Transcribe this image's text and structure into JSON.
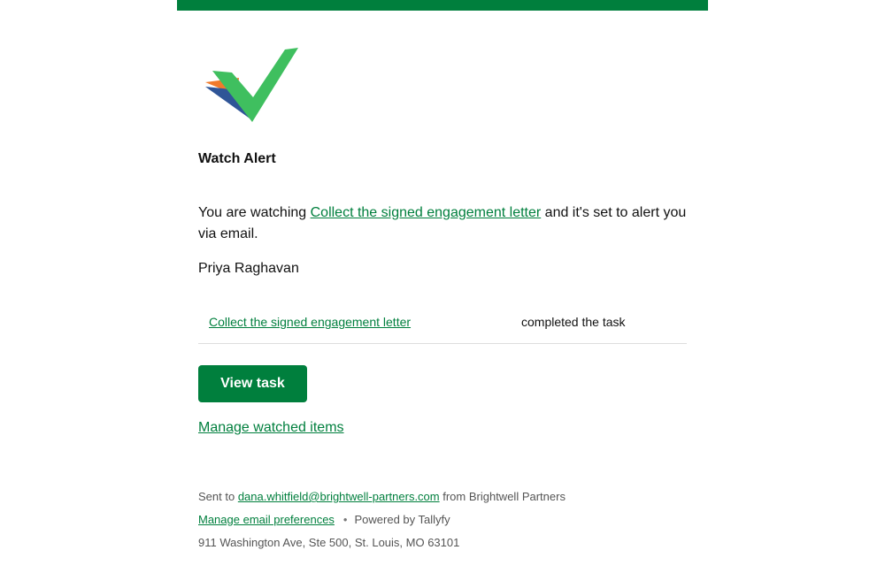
{
  "colors": {
    "brand_green": "#007f3d",
    "link_green": "#007f3d",
    "logo_green": "#3fbf5f",
    "logo_orange": "#f07a2b",
    "logo_blue": "#2f5597"
  },
  "header": {
    "logo_icon": "checkmark-logo-icon"
  },
  "alert": {
    "title": "Watch Alert",
    "intro_prefix": "You are watching ",
    "intro_link": "Collect the signed engagement letter",
    "intro_suffix": " and it's set to alert you via email.",
    "person_name": "Priya Raghavan"
  },
  "activity": {
    "task_name": "Collect the signed engagement letter",
    "action": "completed the task"
  },
  "actions": {
    "view_task_label": "View task",
    "manage_watched_label": "Manage watched items"
  },
  "footer": {
    "sent_to_prefix": "Sent to ",
    "recipient_email": "dana.whitfield@brightwell-partners.com",
    "from_text": " from Brightwell Partners",
    "manage_prefs_label": "Manage email preferences",
    "separator": "•",
    "powered_by": "Powered by Tallyfy",
    "address": "911 Washington Ave, Ste 500, St. Louis, MO 63101"
  }
}
